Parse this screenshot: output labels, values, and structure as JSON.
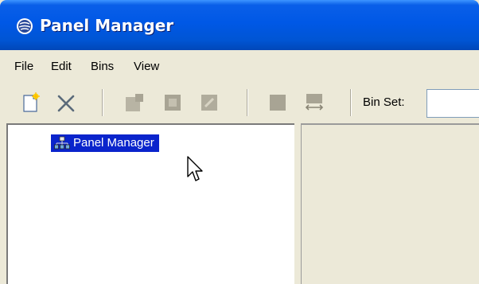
{
  "window": {
    "title": "Panel Manager"
  },
  "menubar": {
    "items": [
      "File",
      "Edit",
      "Bins",
      "View"
    ]
  },
  "toolbar": {
    "buttons": [
      "new-icon",
      "delete-icon",
      "add-bin-icon",
      "bin-icon",
      "edit-bin-icon",
      "bin-set-icon",
      "swap-icon"
    ],
    "bin_set_label": "Bin Set:",
    "bin_set_value": ""
  },
  "tree": {
    "root_label": "Panel Manager",
    "selected": true
  },
  "colors": {
    "title_bar": "#0055d4",
    "selection": "#0a24cc",
    "chrome": "#ece9d8"
  }
}
